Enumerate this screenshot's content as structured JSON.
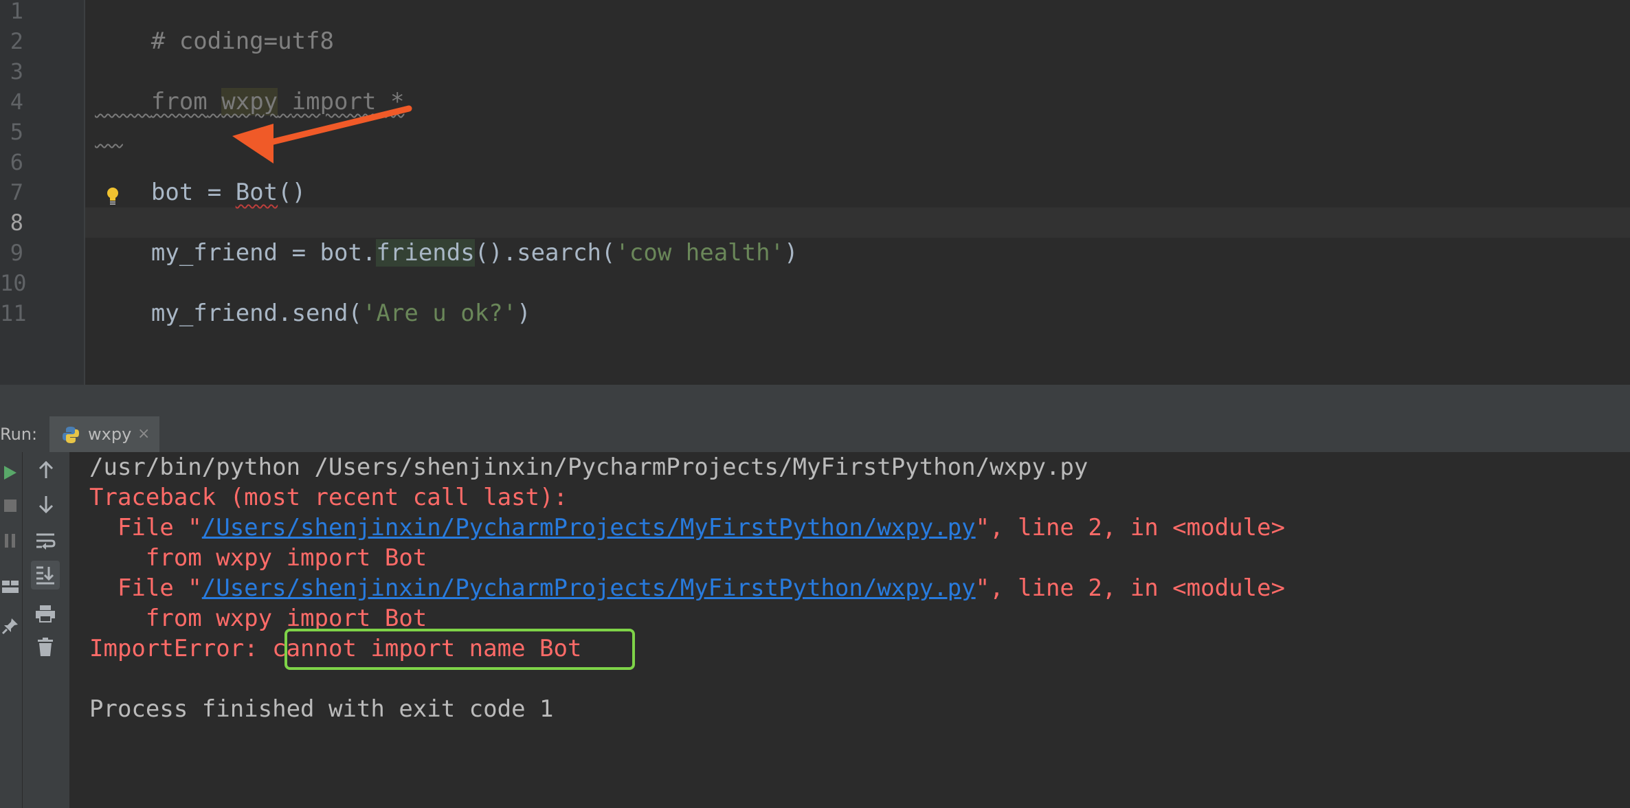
{
  "editor": {
    "line_numbers": [
      "1",
      "2",
      "3",
      "4",
      "5",
      "6",
      "7",
      "8",
      "9",
      "10",
      "11"
    ],
    "current_line": 8,
    "lines": {
      "l1": {
        "comment": "# coding=utf8"
      },
      "l3": {
        "kw_from": "from",
        "space1": " ",
        "module": "wxpy",
        "space2": " ",
        "kw_import": "import",
        "star": " *"
      },
      "l6": {
        "prefix": "bot = ",
        "cls": "Bot",
        "suffix": "()"
      },
      "l8": {
        "prefix": "my_friend = bot.",
        "method": "friends",
        "mid": "().search(",
        "str": "'cow health'",
        "end": ")"
      },
      "l10": {
        "prefix": "my_friend.send(",
        "str": "'Are u ok?'",
        "end": ")"
      }
    },
    "annotation_color": "#f05a28"
  },
  "run_panel": {
    "label": "Run:",
    "tab_label": "wxpy",
    "tab_close": "×"
  },
  "console": {
    "cmd": "/usr/bin/python /Users/shenjinxin/PycharmProjects/MyFirstPython/wxpy.py",
    "traceback": "Traceback (most recent call last):",
    "file1_pre": "  File \"",
    "file1_link": "/Users/shenjinxin/PycharmProjects/MyFirstPython/wxpy.py",
    "file1_post": "\", line 2, in <module>",
    "src1": "    from wxpy import Bot",
    "file2_pre": "  File \"",
    "file2_link": "/Users/shenjinxin/PycharmProjects/MyFirstPython/wxpy.py",
    "file2_post": "\", line 2, in <module>",
    "src2": "    from wxpy import Bot",
    "error_type": "ImportError: ",
    "error_msg": "cannot import name Bot",
    "exit": "Process finished with exit code 1",
    "highlight_color": "#7ed348"
  }
}
